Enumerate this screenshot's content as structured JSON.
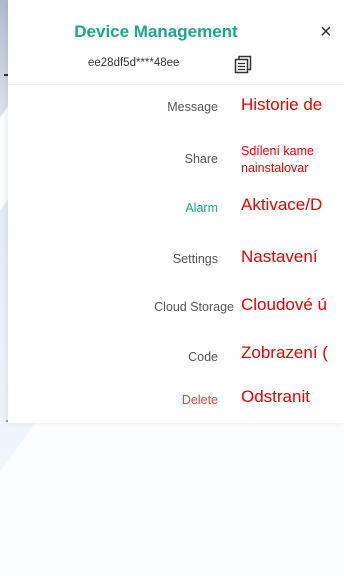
{
  "header": {
    "title": "Device Management",
    "close_symbol": "×",
    "device_id": "ee28df5d****48ee"
  },
  "menu": {
    "items": [
      {
        "label": "Message",
        "note": "Historie de"
      },
      {
        "label": "Share",
        "note_line1": "Sdílení kame",
        "note_line2": "nainstalovar"
      },
      {
        "label": "Alarm",
        "note": "Aktivace/D"
      },
      {
        "label": "Settings",
        "note": "Nastavení"
      },
      {
        "label": "Cloud Storage",
        "note": "Cloudové ú"
      },
      {
        "label": "Code",
        "note": "Zobrazení ("
      },
      {
        "label": "Delete",
        "note": "Odstranit"
      }
    ]
  },
  "colors": {
    "accent": "#1aa68f",
    "danger": "#e8413f",
    "annotation": "#e60000"
  }
}
